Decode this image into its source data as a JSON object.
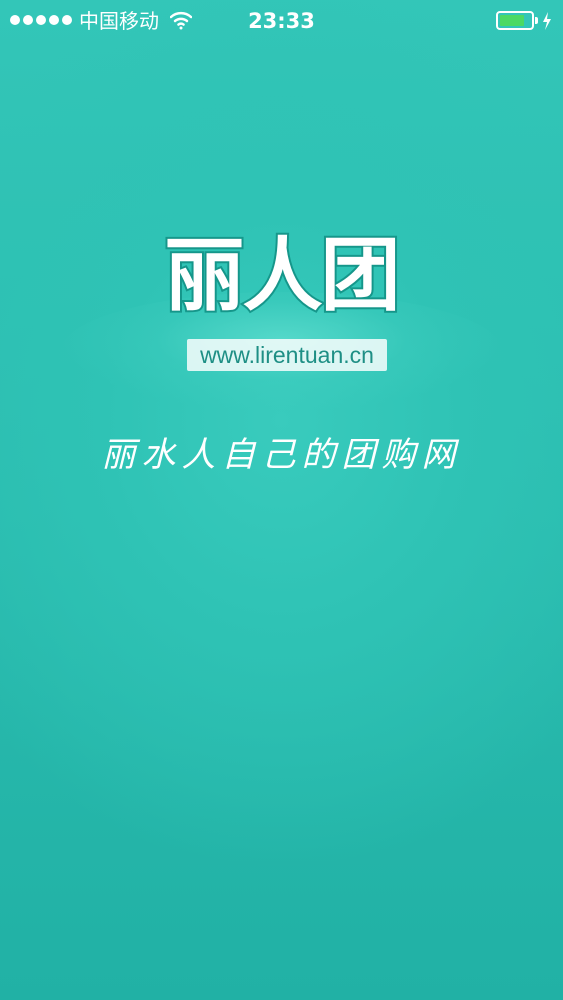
{
  "status_bar": {
    "carrier": "中国移动",
    "time": "23:33",
    "signal_icon": "signal-dots-icon",
    "wifi_icon": "wifi-icon",
    "battery_icon": "battery-icon",
    "charging_icon": "charging-bolt-icon",
    "battery_level": 0.8,
    "battery_color": "#4cd964"
  },
  "splash": {
    "logo_text": "丽人团",
    "url": "www.lirentuan.cn",
    "slogan": "丽水人自己的团购网",
    "accent_color": "#2bbdb0"
  }
}
